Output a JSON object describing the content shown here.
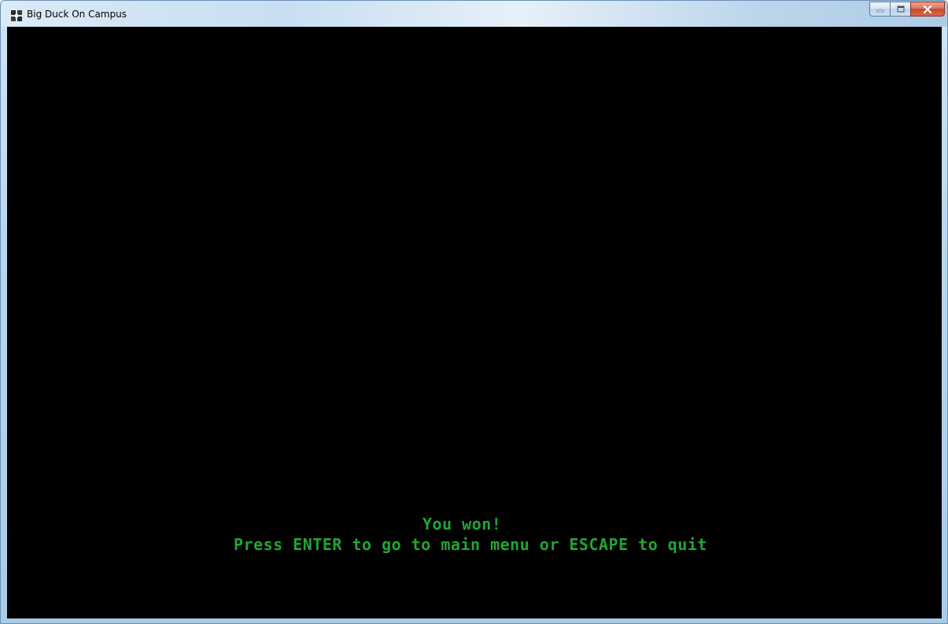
{
  "window": {
    "title": "Big Duck On Campus",
    "app_icon": "duck-app-icon",
    "controls": {
      "minimize_icon": "minimize-icon",
      "maximize_icon": "maximize-icon",
      "close_icon": "close-icon"
    }
  },
  "game": {
    "background_color": "#000000",
    "text_color": "#22a532",
    "result_message": "You won!",
    "instruction_message": "Press ENTER to go to main menu or ESCAPE to quit"
  }
}
